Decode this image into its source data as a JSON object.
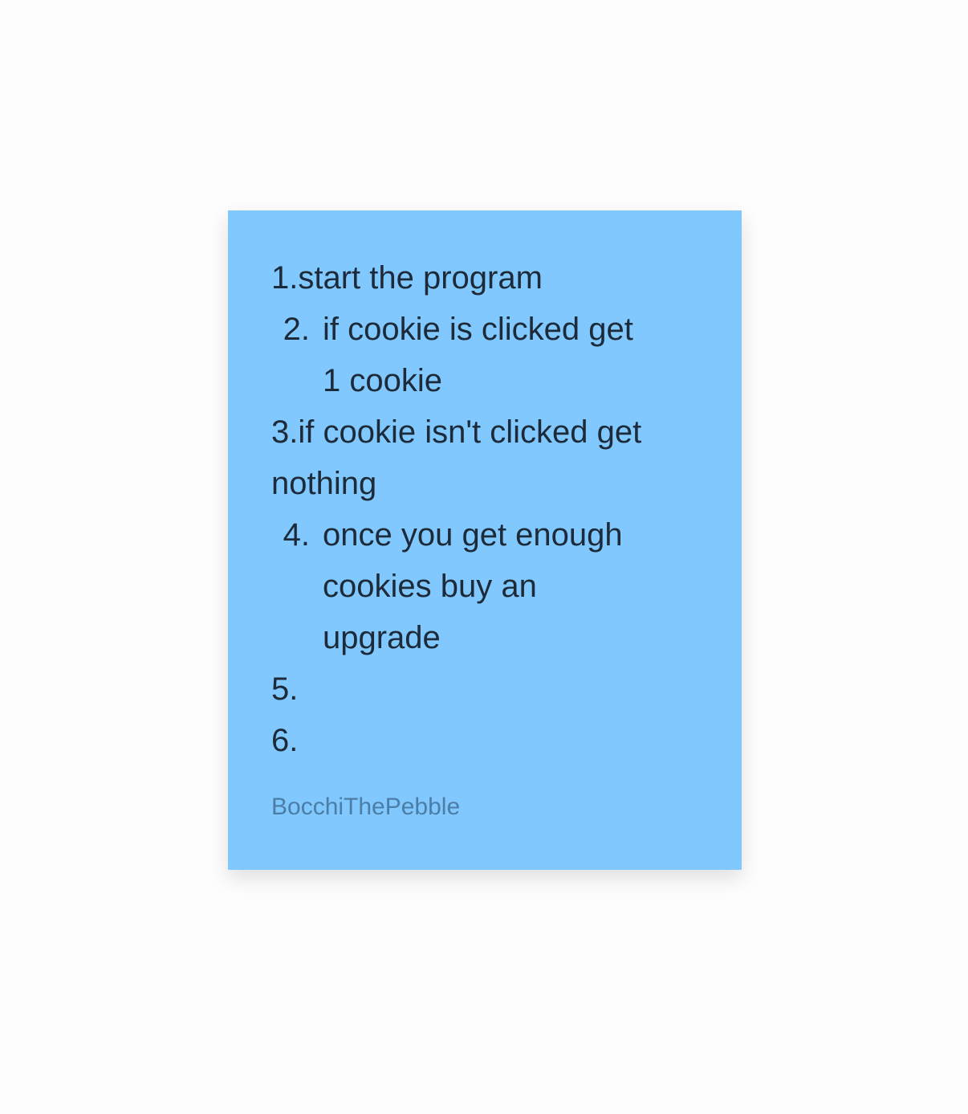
{
  "note": {
    "background": "#81c8fe",
    "lines": [
      "1.start the program",
      {
        "num": "2.",
        "text": "if cookie is clicked get 1 cookie"
      },
      "3.if cookie isn't clicked get",
      "nothing",
      {
        "num": "4.",
        "text": "once you get enough cookies buy an upgrade"
      },
      "5.",
      "6."
    ],
    "author": "BocchiThePebble"
  }
}
